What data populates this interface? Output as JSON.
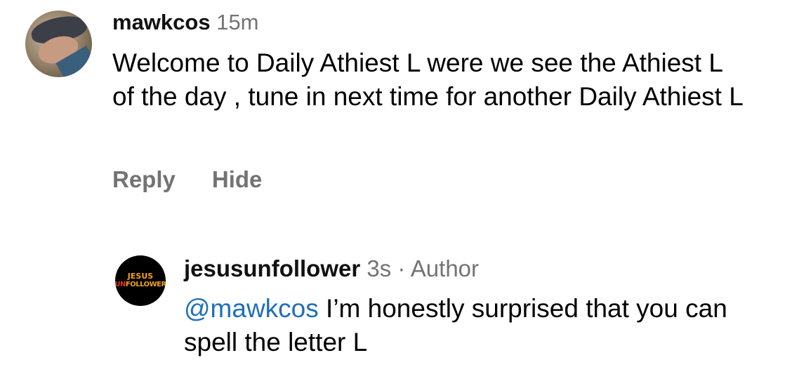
{
  "comments": [
    {
      "username": "mawkcos",
      "time": "15m",
      "text": "Welcome to Daily Athiest L were we see the Athiest L of the day , tune in next time for another Daily Athiest L",
      "actions": {
        "reply": "Reply",
        "hide": "Hide"
      }
    }
  ],
  "reply": {
    "username": "jesusunfollower",
    "time": "3s",
    "separator": "·",
    "badge": "Author",
    "mention": "@mawkcos",
    "text": "I’m honestly surprised that you can spell the letter L",
    "avatar_logo": {
      "line1": "JESUS",
      "line2_a": "UN",
      "line2_b": "FOLLOWER"
    }
  }
}
